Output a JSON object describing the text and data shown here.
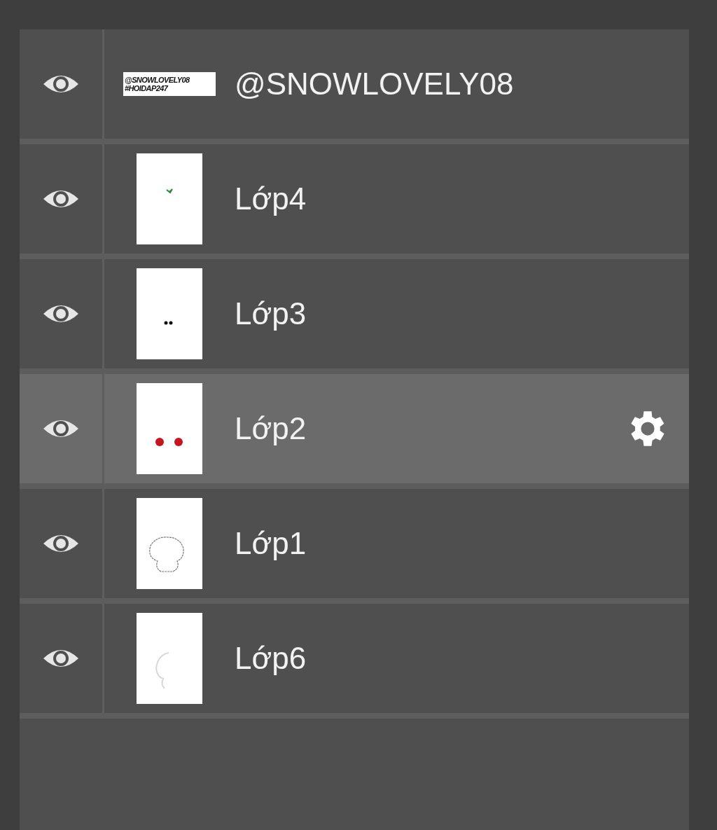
{
  "layers": [
    {
      "name": "@SNOWLOVELY08",
      "visible": true,
      "selected": false,
      "kind": "text",
      "thumbnail_text": "@SNOWLOVELY08 #HOIDAP247"
    },
    {
      "name": "Lớp4",
      "visible": true,
      "selected": false,
      "kind": "green-mark"
    },
    {
      "name": "Lớp3",
      "visible": true,
      "selected": false,
      "kind": "dark-dots"
    },
    {
      "name": "Lớp2",
      "visible": true,
      "selected": true,
      "kind": "red-dots"
    },
    {
      "name": "Lớp1",
      "visible": true,
      "selected": false,
      "kind": "outline"
    },
    {
      "name": "Lớp6",
      "visible": true,
      "selected": false,
      "kind": "faint-arc"
    }
  ]
}
